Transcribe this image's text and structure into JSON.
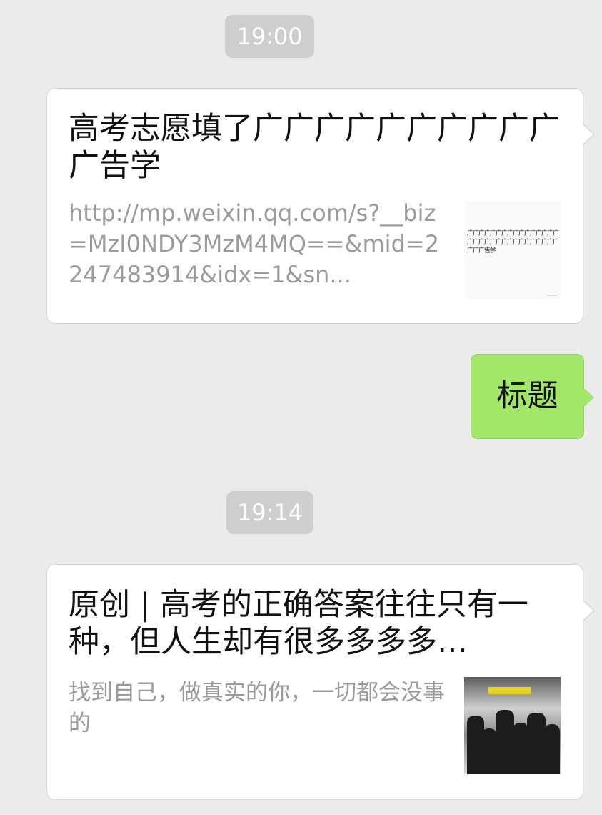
{
  "messages": [
    {
      "time": "19:00",
      "card": {
        "title": "高考志愿填了广广广广广广广广广广广告学",
        "description": "http://mp.weixin.qq.com/s?__biz=MzI0NDY3MzM4MQ==&mid=2247483914&idx=1&sn...",
        "thumbnail_text": "广广广广广广广广广广广广广广广广广广广广广广广广广广广广广广广广广广广告学"
      }
    },
    {
      "sent_text": "标题"
    },
    {
      "time": "19:14",
      "card": {
        "title": "原创 | 高考的正确答案往往只有一种，但人生却有很多多多多…",
        "description": "找到自己，做真实的你，一切都会没事的",
        "thumbnail_sign_color": "#e9d32b"
      }
    }
  ],
  "colors": {
    "background": "#ebebeb",
    "time_pill": "#cecece",
    "sent_bubble": "#a3e768",
    "card": "#ffffff",
    "description": "#9b9b9b"
  }
}
